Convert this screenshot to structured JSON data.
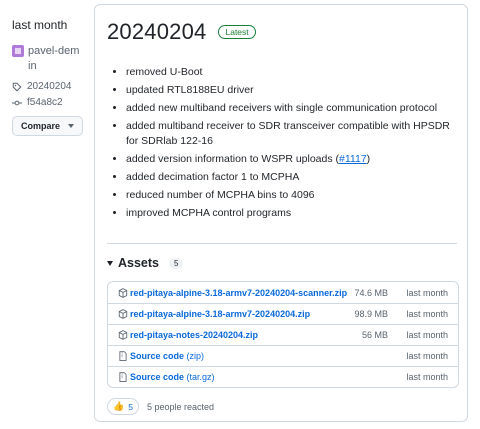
{
  "sidebar": {
    "time": "last month",
    "author": "pavel-dem",
    "in_label": "in",
    "tag": "20240204",
    "commit": "f54a8c2",
    "compare_label": "Compare"
  },
  "release": {
    "title": "20240204",
    "latest_label": "Latest",
    "notes": [
      {
        "text": "removed U-Boot"
      },
      {
        "text": "updated RTL8188EU driver"
      },
      {
        "text": "added new multiband receivers with single communication protocol"
      },
      {
        "text": "added multiband receiver to SDR transceiver compatible with HPSDR for SDRlab 122-16"
      },
      {
        "text": "added version information to WSPR uploads (",
        "link": "#1117",
        "suffix": ")"
      },
      {
        "text": "added decimation factor 1 to MCPHA"
      },
      {
        "text": "reduced number of MCPHA bins to 4096"
      },
      {
        "text": "improved MCPHA control programs"
      }
    ]
  },
  "assets": {
    "title": "Assets",
    "count": "5",
    "items": [
      {
        "name": "red-pitaya-alpine-3.18-armv7-20240204-scanner.zip",
        "size": "74.6 MB",
        "time": "last month",
        "icon": "package-icon"
      },
      {
        "name": "red-pitaya-alpine-3.18-armv7-20240204.zip",
        "size": "98.9 MB",
        "time": "last month",
        "icon": "package-icon"
      },
      {
        "name": "red-pitaya-notes-20240204.zip",
        "size": "56 MB",
        "time": "last month",
        "icon": "package-icon"
      },
      {
        "name": "Source code",
        "format": "(zip)",
        "time": "last month",
        "icon": "file-zip-icon"
      },
      {
        "name": "Source code",
        "format": "(tar.gz)",
        "time": "last month",
        "icon": "file-zip-icon"
      }
    ]
  },
  "reactions": {
    "emoji": "👍",
    "count": "5",
    "text": "5 people reacted"
  },
  "colors": {
    "link": "#0969da",
    "latest_green": "#1a7f37",
    "border": "#d1d9e0",
    "muted": "#59636e"
  }
}
